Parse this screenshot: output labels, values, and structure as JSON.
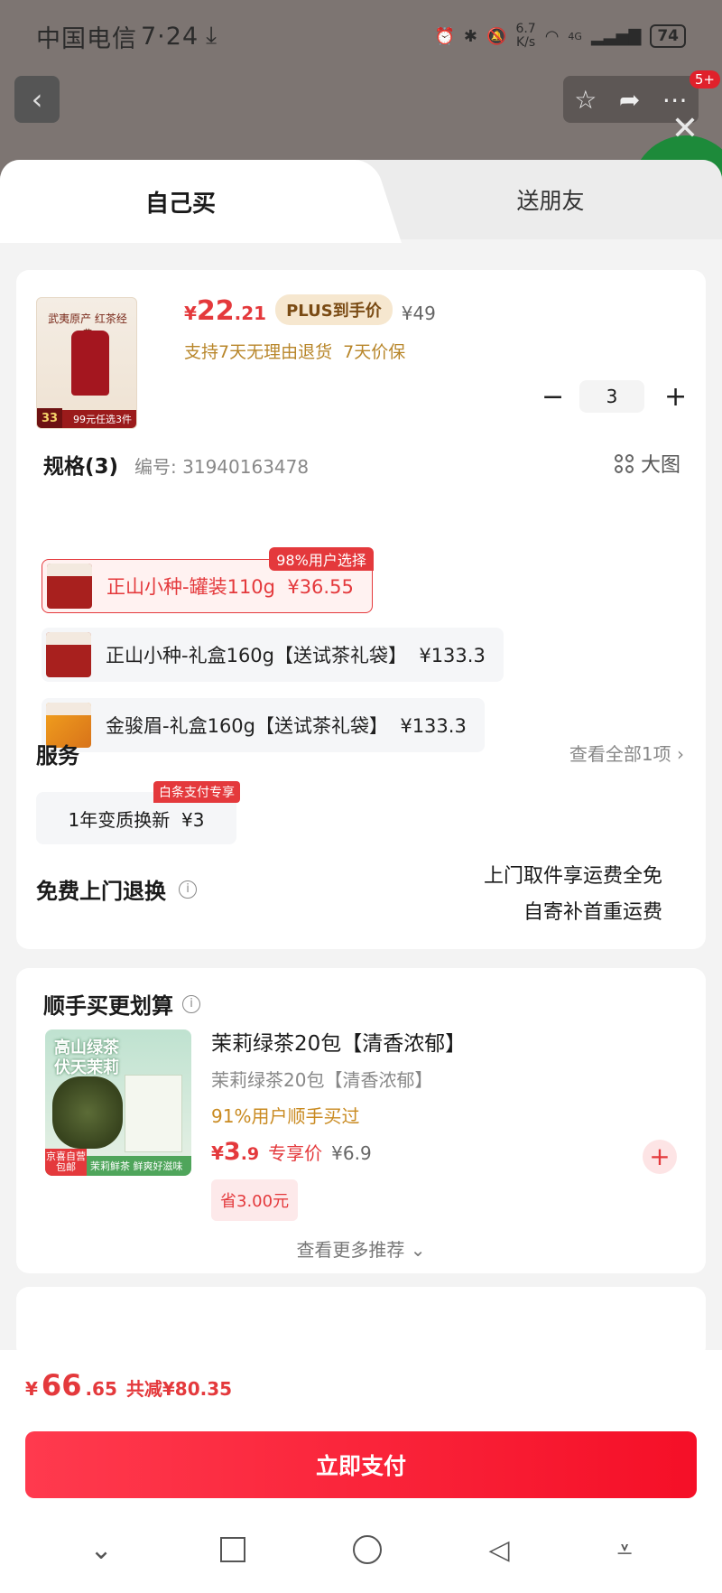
{
  "status": {
    "carrier": "中国电信",
    "time": "7·24",
    "net_speed": "6.7\nK/s",
    "signal": "4G",
    "battery": "74"
  },
  "nav": {
    "badge": "5+"
  },
  "tabs": [
    "自己买",
    "送朋友"
  ],
  "product": {
    "thumb_label": "武夷原产 红茶经典",
    "thumb_num": "33",
    "thumb_foot": "99元任选3件",
    "price_symbol": "¥",
    "price_int": "22",
    "price_dec": ".21",
    "plus_tag": "PLUS到手价",
    "orig_price": "¥49",
    "guarantee": "支持7天无理由退货  7天价保",
    "quantity": "3",
    "minus_label": "−",
    "plus_label": "+"
  },
  "specs": {
    "title": "规格(3)",
    "code": "编号: 31940163478",
    "big_image": "大图",
    "options": [
      {
        "label": "正山小种-罐装110g  ¥36.55",
        "badge": "98%用户选择"
      },
      {
        "label": "正山小种-礼盒160g【送试茶礼袋】  ¥133.3"
      },
      {
        "label": "金骏眉-礼盒160g【送试茶礼袋】  ¥133.3"
      }
    ]
  },
  "service": {
    "title": "服务",
    "view_all": "查看全部1项",
    "chip": "1年变质换新  ¥3",
    "chip_tag": "白条支付专享"
  },
  "returns": {
    "title": "免费上门退换",
    "line1": "上门取件享运费全免",
    "line2": "自寄补首重运费"
  },
  "recommend": {
    "title": "顺手买更划算",
    "thumb_text": "高山绿茶\n伏天茉莉",
    "thumb_bar": "茉莉鲜茶 鲜爽好滋味",
    "thumb_pkg": "京喜自营\n包邮",
    "name": "茉莉绿茶20包【清香浓郁】",
    "sub": "茉莉绿茶20包【清香浓郁】",
    "pct": "91%用户顺手买过",
    "price_symbol": "¥",
    "price_int": "3",
    "price_dec": ".9",
    "exclusive": "专享价",
    "orig_price": "¥6.9",
    "save": "省3.00元",
    "add_label": "+",
    "more": "查看更多推荐 ⌄"
  },
  "checkout": {
    "symbol": "¥",
    "total_int": "66",
    "total_dec": ".65",
    "discount": "共减¥80.35",
    "pay_label": "立即支付"
  },
  "colors": {
    "accent": "#e4393c",
    "gold": "#c98a20"
  }
}
